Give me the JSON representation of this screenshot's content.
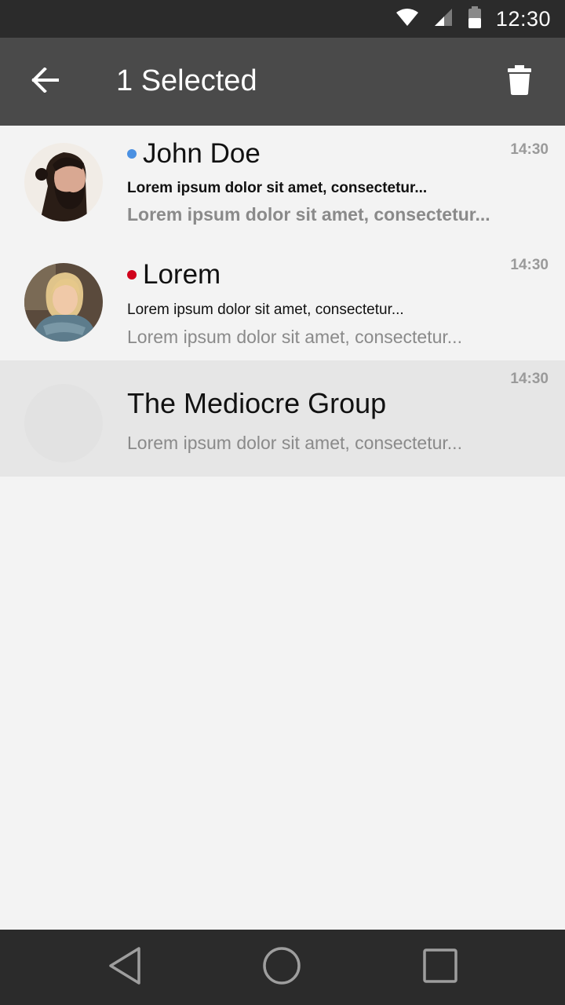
{
  "status_bar": {
    "time": "12:30",
    "icons": [
      "wifi-icon",
      "cell-signal-icon",
      "battery-icon"
    ]
  },
  "app_bar": {
    "back_icon": "arrow-back-icon",
    "title": "1 Selected",
    "delete_icon": "trash-icon"
  },
  "conversations": [
    {
      "name": "John Doe",
      "unread_dot_color": "#4a90e2",
      "line1": "Lorem ipsum dolor sit amet, consectetur...",
      "line2": "Lorem ipsum dolor sit amet, consectetur...",
      "time": "14:30",
      "selected": false
    },
    {
      "name": "Lorem",
      "unread_dot_color": "#d0021b",
      "line1": "Lorem ipsum dolor sit amet, consectetur...",
      "line2": "Lorem ipsum dolor sit amet, consectetur...",
      "time": "14:30",
      "selected": false
    },
    {
      "name": "The Mediocre Group",
      "line2": "Lorem ipsum dolor sit amet, consectetur...",
      "time": "14:30",
      "selected": true
    }
  ],
  "nav_bar": {
    "icons": [
      "back-triangle-icon",
      "home-circle-icon",
      "recents-square-icon"
    ]
  },
  "colors": {
    "status_bar": "#2b2b2b",
    "app_bar": "#4a4a4a",
    "background": "#f3f3f3",
    "selected_row": "#e6e6e6"
  }
}
